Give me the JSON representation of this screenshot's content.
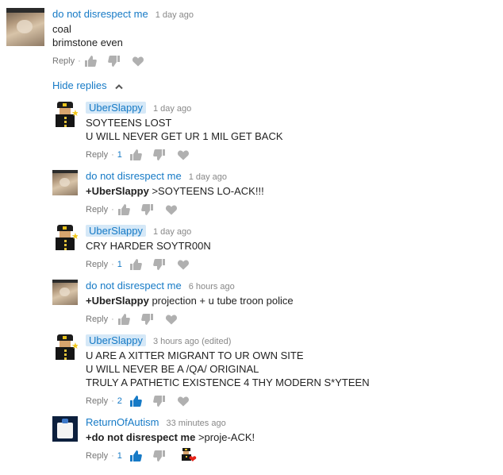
{
  "top_comment": {
    "author": "do not disrespect me",
    "time": "1 day ago",
    "lines": [
      "coal",
      "brimstone even"
    ],
    "reply_label": "Reply",
    "separator": "·"
  },
  "hide_replies_label": "Hide replies",
  "replies": [
    {
      "author": "UberSlappy",
      "time": "1 day ago",
      "lines": [
        "SOYTEENS LOST",
        "U WILL NEVER GET UR 1 MIL GET BACK"
      ],
      "reply_label": "Reply",
      "separator": "·",
      "likes": "1"
    },
    {
      "author": "do not disrespect me",
      "time": "1 day ago",
      "mention": "+UberSlappy",
      "text": " >SOYTEENS LO-ACK!!!",
      "reply_label": "Reply",
      "separator": "·"
    },
    {
      "author": "UberSlappy",
      "time": "1 day ago",
      "lines": [
        "CRY HARDER SOYTR00N"
      ],
      "reply_label": "Reply",
      "separator": "·",
      "likes": "1"
    },
    {
      "author": "do not disrespect me",
      "time": "6 hours ago",
      "mention": "+UberSlappy",
      "text": " projection + u tube troon police",
      "reply_label": "Reply",
      "separator": "·"
    },
    {
      "author": "UberSlappy",
      "time": "3 hours ago (edited)",
      "lines": [
        "U ARE A XITTER MIGRANT TO UR OWN SITE",
        "U WILL NEVER BE A /QA/ ORIGINAL",
        "TRULY A PATHETIC EXISTENCE 4 THY MODERN S*YTEEN"
      ],
      "reply_label": "Reply",
      "separator": "·",
      "likes": "2"
    },
    {
      "author": "ReturnOfAutism",
      "time": "33 minutes ago",
      "mention": "+do not disrespect me",
      "text": " >proje-ACK!",
      "reply_label": "Reply",
      "separator": "·",
      "likes": "1"
    }
  ],
  "icons": {
    "like": "thumbs-up-icon",
    "dislike": "thumbs-down-icon",
    "heart": "heart-icon",
    "chevron": "chevron-up-icon",
    "creator_heart": "creator-heart-icon"
  },
  "colors": {
    "link_blue": "#167ac6",
    "icon_grey": "#b0b0b0",
    "liked_blue": "#167ac6",
    "highlight_bg": "#d5e8f7",
    "heart_red": "#e62117"
  }
}
